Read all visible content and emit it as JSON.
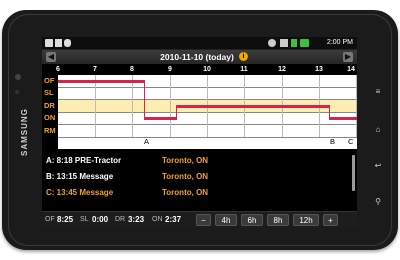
{
  "device": {
    "brand": "SAMSUNG"
  },
  "status_bar": {
    "time": "2:00 PM"
  },
  "nav": {
    "date_label": "2010-11-10 (today)",
    "prev_icon": "chevron-left-icon",
    "next_icon": "chevron-right-icon",
    "info_icon": "info-icon"
  },
  "timeline": {
    "hours": [
      "6",
      "7",
      "8",
      "9",
      "10",
      "11",
      "12",
      "13",
      "14"
    ],
    "rows": [
      "OF",
      "SL",
      "DR",
      "ON",
      "RM"
    ],
    "markers": [
      "A",
      "B",
      "C"
    ],
    "segments": [
      {
        "row": "OF",
        "start": 6.0,
        "end": 8.3
      },
      {
        "row": "ON",
        "start": 8.3,
        "end": 9.15
      },
      {
        "row": "DR",
        "start": 9.15,
        "end": 13.25
      },
      {
        "row": "ON",
        "start": 13.25,
        "end": 14.2
      }
    ]
  },
  "events": [
    {
      "text": "A: 8:18 PRE-Tractor",
      "location": "Toronto, ON",
      "color": "#f0a030"
    },
    {
      "text": "B: 13:15 Message",
      "location": "Toronto, ON",
      "color": "#f0a030"
    },
    {
      "text": "C: 13:45 Message",
      "location": "Toronto, ON",
      "color": "#f0a030"
    }
  ],
  "summary": {
    "of_label": "OF",
    "of_value": "8:25",
    "sl_label": "SL",
    "sl_value": "0:00",
    "dr_label": "DR",
    "dr_value": "3:23",
    "on_label": "ON",
    "on_value": "2:37"
  },
  "zoom": {
    "minus": "−",
    "h4": "4h",
    "h6": "6h",
    "h8": "8h",
    "h12": "12h",
    "plus": "+"
  }
}
